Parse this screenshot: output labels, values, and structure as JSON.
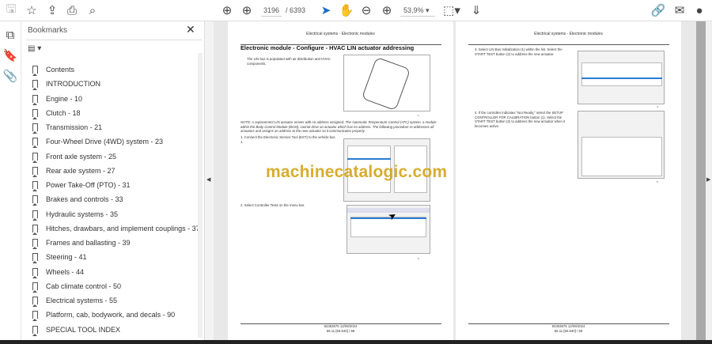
{
  "toolbar": {
    "page_current": "3196",
    "page_total": "/ 6393",
    "zoom": "53,9%"
  },
  "icons": {
    "save": "save-icon",
    "bookmark": "star-icon",
    "upload": "cloud-upload-icon",
    "print": "print-icon",
    "find": "search-icon",
    "prev": "arrow-up-circle-icon",
    "next": "arrow-down-circle-icon",
    "select": "cursor-icon",
    "hand": "hand-icon",
    "zoom_out": "zoom-out-icon",
    "zoom_in": "zoom-in-icon",
    "fit": "fit-page-icon",
    "scroll": "scroll-mode-icon",
    "share": "share-link-icon",
    "email": "email-icon",
    "account": "account-icon"
  },
  "panel": {
    "title": "Bookmarks",
    "close": "✕",
    "options": "▤ ▾",
    "items": [
      {
        "label": "Contents"
      },
      {
        "label": "INTRODUCTION"
      },
      {
        "label": "Engine - 10"
      },
      {
        "label": "Clutch - 18"
      },
      {
        "label": "Transmission - 21"
      },
      {
        "label": "Four-Wheel Drive (4WD) system - 23"
      },
      {
        "label": "Front axle system - 25"
      },
      {
        "label": "Rear axle system - 27"
      },
      {
        "label": "Power Take-Off (PTO) - 31"
      },
      {
        "label": "Brakes and controls - 33"
      },
      {
        "label": "Hydraulic systems - 35"
      },
      {
        "label": "Hitches, drawbars, and implement couplings - 37"
      },
      {
        "label": "Frames and ballasting - 39"
      },
      {
        "label": "Steering - 41"
      },
      {
        "label": "Wheels - 44"
      },
      {
        "label": "Cab climate control - 50"
      },
      {
        "label": "Electrical systems - 55"
      },
      {
        "label": "Platform, cab, bodywork, and decals - 90"
      },
      {
        "label": "SPECIAL TOOL INDEX"
      }
    ]
  },
  "page_left": {
    "header": "Electrical systems - Electronic modules",
    "title": "Electronic module - Configure - HVAC LIN actuator addressing",
    "intro": "The LIN bus is populated with air distribution and HVAC components.",
    "note": "NOTE: A replacement LIN actuator arrives with no address assigned. The Automatic Temperature Control (ATC) system, a module within the Body Control Module (BCM), cannot drive an actuator which has no address. The following procedure re-addresses all actuators and assigns an address to the new actuator so it communicates properly.",
    "step1": "1. Connect the Electronic Service Tool (EST) to the vehicle bus 1.",
    "step2": "2. Select Controller Tests on the menu bar.",
    "fig1": "1",
    "fig2": "2",
    "fig3": "3",
    "footer1": "92363675 12/09/2024",
    "footer2": "55.11 [55.640] / 58"
  },
  "page_right": {
    "header": "Electrical systems - Electronic modules",
    "step3": "3. Select LIN Bus Initialization (1) within the list. Select the START TEST button (2) to address the new actuator.",
    "step4": "4. If the controller indicates \"Not Ready,\" select the SETUP CONTROLLER FOR CALIBRATION button (1). Select the START TEST button (2) to address the new actuator when it becomes active.",
    "fig4": "4",
    "fig5": "5",
    "footer1": "92363675 12/09/2024",
    "footer2": "55.11 [55.640] / 59"
  },
  "watermark": "machinecatalogic.com"
}
